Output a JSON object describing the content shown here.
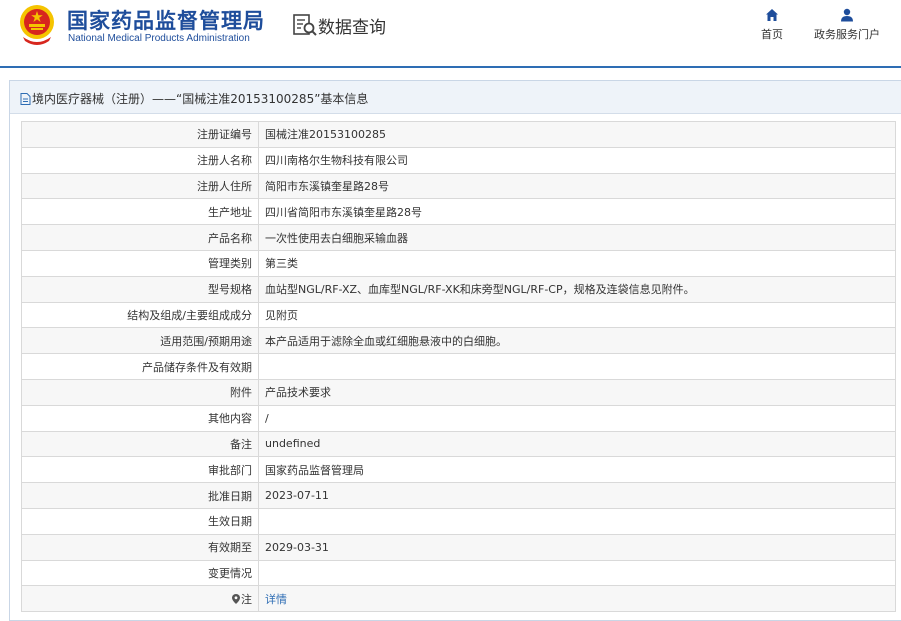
{
  "header": {
    "logo_cn": "国家药品监督管理局",
    "logo_en": "National Medical Products Administration",
    "query_title": "数据查询",
    "nav": [
      {
        "label": "首页",
        "icon": "home-icon"
      },
      {
        "label": "政务服务门户",
        "icon": "user-icon"
      }
    ]
  },
  "panel": {
    "title": "境内医疗器械（注册）——“国械注准20153100285”基本信息"
  },
  "rows": [
    {
      "label": "注册证编号",
      "value": "国械注准20153100285"
    },
    {
      "label": "注册人名称",
      "value": "四川南格尔生物科技有限公司"
    },
    {
      "label": "注册人住所",
      "value": "简阳市东溪镇奎星路28号"
    },
    {
      "label": "生产地址",
      "value": "四川省简阳市东溪镇奎星路28号"
    },
    {
      "label": "产品名称",
      "value": "一次性使用去白细胞采输血器"
    },
    {
      "label": "管理类别",
      "value": "第三类"
    },
    {
      "label": "型号规格",
      "value": "血站型NGL/RF-XZ、血库型NGL/RF-XK和床旁型NGL/RF-CP，规格及连袋信息见附件。"
    },
    {
      "label": "结构及组成/主要组成成分",
      "value": "见附页"
    },
    {
      "label": "适用范围/预期用途",
      "value": "本产品适用于滤除全血或红细胞悬液中的白细胞。"
    },
    {
      "label": "产品储存条件及有效期",
      "value": ""
    },
    {
      "label": "附件",
      "value": "产品技术要求"
    },
    {
      "label": "其他内容",
      "value": "/"
    },
    {
      "label": "备注",
      "value": "undefined"
    },
    {
      "label": "审批部门",
      "value": "国家药品监督管理局"
    },
    {
      "label": "批准日期",
      "value": "2023-07-11"
    },
    {
      "label": "生效日期",
      "value": ""
    },
    {
      "label": "有效期至",
      "value": "2029-03-31"
    },
    {
      "label": "变更情况",
      "value": ""
    },
    {
      "label": "注",
      "value": "详情"
    }
  ],
  "colors": {
    "brand_blue": "#1e4d9b",
    "link_blue": "#2e6db4",
    "emblem_red": "#d7261e",
    "emblem_gold": "#f5c400"
  }
}
